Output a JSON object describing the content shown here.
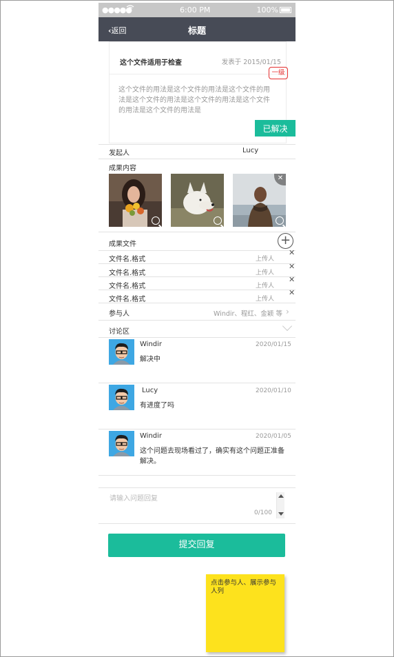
{
  "status_bar": {
    "signal": "●●●●●",
    "time": "6:00 PM",
    "battery": "100%"
  },
  "nav": {
    "back_label": "返回",
    "title": "标题"
  },
  "issue": {
    "title": "这个文件适用于检查",
    "date": "发表于 2015/01/15",
    "level": "一级",
    "body": "这个文件的用法是这个文件的用法是这个文件的用法是这个文件的用法是这个文件的用法是这个文件的用法是这个文件的用法是",
    "status_button": "已解决"
  },
  "initiator": {
    "label": "发起人",
    "value": "Lucy"
  },
  "results": {
    "label": "成果内容",
    "photos": [
      "woman-with-flowers",
      "white-dog",
      "man-at-sea"
    ]
  },
  "files": {
    "label": "成果文件",
    "items": [
      {
        "name": "文件名.格式",
        "uploader": "上传人"
      },
      {
        "name": "文件名.格式",
        "uploader": "上传人"
      },
      {
        "name": "文件名.格式",
        "uploader": "上传人"
      },
      {
        "name": "文件名.格式",
        "uploader": "上传人"
      }
    ]
  },
  "participants": {
    "label": "参与人",
    "value": "Windir、程红、金颖 等"
  },
  "discussion": {
    "label": "讨论区",
    "comments": [
      {
        "name": "Windir",
        "date": "2020/01/15",
        "text": "解决中"
      },
      {
        "name": "Lucy",
        "date": "2020/01/10",
        "text": "有进度了吗"
      },
      {
        "name": "Windir",
        "date": "2020/01/05",
        "text": "这个问题去现场看过了，确实有这个问题正准备解决。"
      }
    ]
  },
  "reply": {
    "placeholder": "请输入问题回复",
    "counter": "0/100",
    "submit": "提交回复"
  },
  "note": {
    "text": "点击参与人、展示参与人列"
  },
  "colors": {
    "accent": "#1bbc9b",
    "navbar": "#474b56",
    "level": "#e52d2d",
    "sticky": "#fde21d"
  }
}
